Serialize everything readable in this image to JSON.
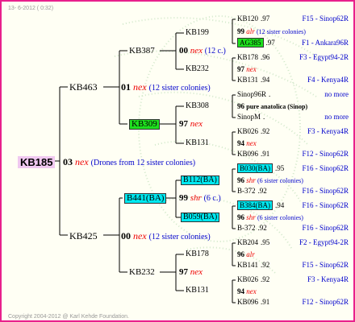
{
  "header": "13- 6-2012 ( 0:32)",
  "footer": "Copyright 2004-2012 @ Karl Kehde Foundation.",
  "root": {
    "id": "KB185",
    "num": "03",
    "mark": "nex",
    "note": "(Drones from 12 sister colonies)"
  },
  "gen1": [
    {
      "id": "KB463",
      "num": "01",
      "mark": "nex",
      "note": "(12 sister colonies)"
    },
    {
      "id": "KB425",
      "num": "00",
      "mark": "nex",
      "note": "(12 sister colonies)"
    }
  ],
  "gen2": [
    {
      "id": "KB387",
      "num": "00",
      "mark": "nex",
      "note": "(12 c.)"
    },
    {
      "id": "KB309",
      "num": "97",
      "mark": "nex"
    },
    {
      "id": "B441(BA)",
      "num": "99",
      "mark": "shr",
      "note": "(6 c.)"
    },
    {
      "id": "KB232",
      "num": "97",
      "mark": "nex"
    }
  ],
  "gen3": [
    {
      "id": "KB199",
      "num": "99",
      "mark": "alr",
      "note": "(12 sister colonies)"
    },
    {
      "id": "KB232",
      "num": "97",
      "mark": "nex"
    },
    {
      "id": "KB308",
      "num": "96",
      "mark": "pure anatolica (Sinop)"
    },
    {
      "id": "KB131",
      "num": "94",
      "mark": "nex"
    },
    {
      "id": "B112(BA)",
      "num": "96",
      "mark": "shr",
      "note": "(6 sister colonies)"
    },
    {
      "id": "B059(BA)",
      "num": "96",
      "mark": "shr",
      "note": "(6 sister colonies)"
    },
    {
      "id": "KB178",
      "num": "96",
      "mark": "alr"
    },
    {
      "id": "KB131",
      "num": "94",
      "mark": "nex"
    }
  ],
  "gen4": [
    {
      "id": "KB120",
      "yr": ".97",
      "link": "F15 - Sinop62R"
    },
    {
      "id": "AG385",
      "yr": ".97",
      "link": "F1 - Ankara96R"
    },
    {
      "id": "KB178",
      "yr": ".96",
      "link": "F3 - Egypt94-2R"
    },
    {
      "id": "KB131",
      "yr": ".94",
      "link": "F4 - Kenya4R"
    },
    {
      "id": "Sinop96R",
      "yr": ".",
      "link": "no more"
    },
    {
      "id": "SinopM",
      "yr": ".",
      "link": "no more"
    },
    {
      "id": "KB026",
      "yr": ".92",
      "link": "F3 - Kenya4R"
    },
    {
      "id": "KB096",
      "yr": ".91",
      "link": "F12 - Sinop62R"
    },
    {
      "id": "B030(BA)",
      "yr": ".95",
      "link": "F16 - Sinop62R"
    },
    {
      "id": "B-372",
      "yr": ".92",
      "link": "F16 - Sinop62R"
    },
    {
      "id": "B384(BA)",
      "yr": ".94",
      "link": "F16 - Sinop62R"
    },
    {
      "id": "B-372",
      "yr": ".92",
      "link": "F16 - Sinop62R"
    },
    {
      "id": "KB204",
      "yr": ".95",
      "link": "F2 - Egypt94-2R"
    },
    {
      "id": "KB141",
      "yr": ".92",
      "link": "F15 - Sinop62R"
    },
    {
      "id": "KB026",
      "yr": ".92",
      "link": "F3 - Kenya4R"
    },
    {
      "id": "KB096",
      "yr": ".91",
      "link": "F12 - Sinop62R"
    }
  ]
}
